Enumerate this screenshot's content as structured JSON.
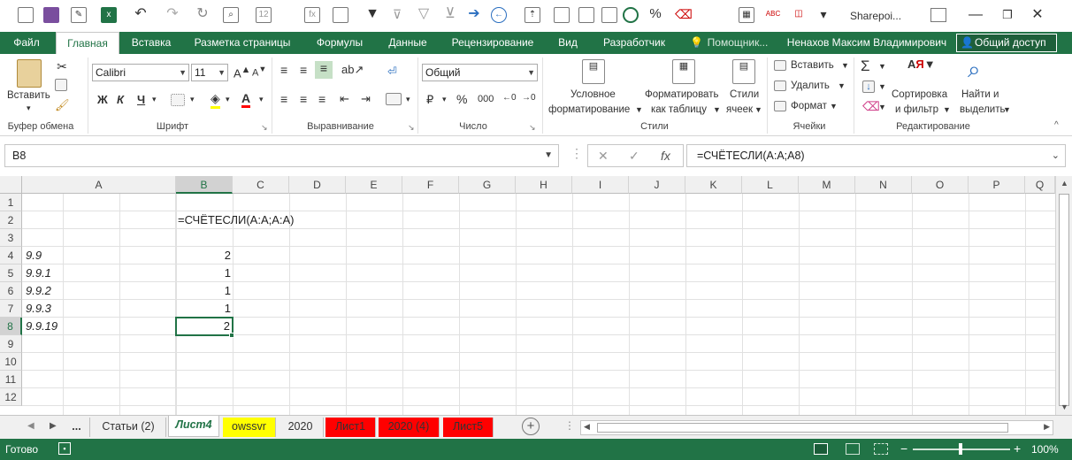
{
  "window": {
    "title": "Sharepoi..."
  },
  "tabs": [
    {
      "label": "Файл"
    },
    {
      "label": "Главная"
    },
    {
      "label": "Вставка"
    },
    {
      "label": "Разметка страницы"
    },
    {
      "label": "Формулы"
    },
    {
      "label": "Данные"
    },
    {
      "label": "Рецензирование"
    },
    {
      "label": "Вид"
    },
    {
      "label": "Разработчик"
    },
    {
      "label": "Помощник..."
    }
  ],
  "user": {
    "name": "Ненахов Максим Владимирович",
    "share_label": "Общий доступ"
  },
  "ribbon": {
    "clipboard": {
      "paste": "Вставить",
      "group": "Буфер обмена"
    },
    "font": {
      "name": "Calibri",
      "size": "11",
      "bold": "Ж",
      "italic": "К",
      "underline": "Ч",
      "group": "Шрифт"
    },
    "alignment": {
      "group": "Выравнивание"
    },
    "number": {
      "format": "Общий",
      "percent": "%",
      "comma": "000",
      "group": "Число"
    },
    "styles": {
      "conditional": "Условное",
      "conditional2": "форматирование",
      "as_table": "Форматировать",
      "as_table2": "как таблицу",
      "cell_styles": "Стили",
      "cell_styles2": "ячеек",
      "group": "Стили"
    },
    "cells": {
      "insert": "Вставить",
      "delete": "Удалить",
      "format": "Формат",
      "group": "Ячейки"
    },
    "editing": {
      "sort": "Сортировка",
      "sort2": "и фильтр",
      "find": "Найти и",
      "find2": "выделить",
      "group": "Редактирование"
    }
  },
  "formula_bar": {
    "name_box": "B8",
    "formula": "=СЧЁТЕСЛИ(A:A;A8)",
    "fx": "fx"
  },
  "columns": [
    "A",
    "B",
    "C",
    "D",
    "E",
    "F",
    "G",
    "H",
    "I",
    "J",
    "K",
    "L",
    "M",
    "N",
    "O",
    "P",
    "Q"
  ],
  "rows": [
    "1",
    "2",
    "3",
    "4",
    "5",
    "6",
    "7",
    "8",
    "9",
    "10",
    "11",
    "12"
  ],
  "cells": {
    "B2": "=СЧЁТЕСЛИ(A:A;A:A)",
    "A4": "9.9",
    "B4": "2",
    "A5": "9.9.1",
    "B5": "1",
    "A6": "9.9.2",
    "B6": "1",
    "A7": "9.9.3",
    "B7": "1",
    "A8": "9.9.19",
    "B8": "2"
  },
  "sheets": [
    {
      "label": "...",
      "color": ""
    },
    {
      "label": "Статьи (2)",
      "color": ""
    },
    {
      "label": "Лист4",
      "color": ""
    },
    {
      "label": "owssvr",
      "color": "#ffff00"
    },
    {
      "label": "2020",
      "color": ""
    },
    {
      "label": "Лист1",
      "color": "#ff0000"
    },
    {
      "label": "2020 (4)",
      "color": "#ff0000"
    },
    {
      "label": "Лист5",
      "color": "#ff0000"
    }
  ],
  "status": {
    "ready": "Готово",
    "zoom": "100%",
    "minus": "−",
    "plus": "+"
  },
  "colors": {
    "accent": "#217346"
  }
}
